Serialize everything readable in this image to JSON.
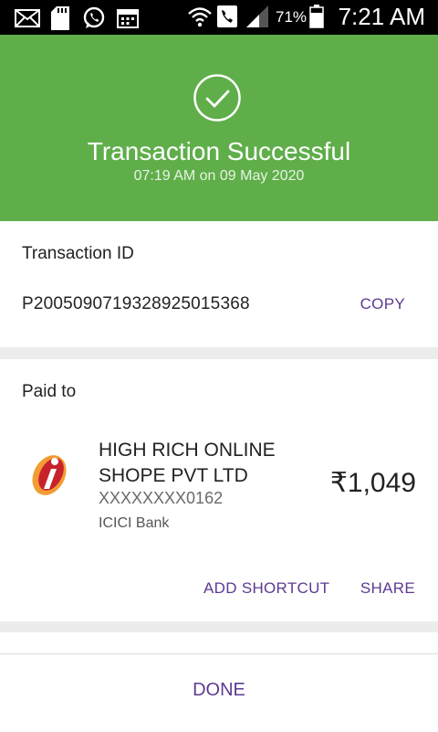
{
  "status_bar": {
    "battery_percent": "71%",
    "time": "7:21 AM"
  },
  "header": {
    "title": "Transaction Successful",
    "timestamp": "07:19 AM on 09 May 2020",
    "accent_color": "#5fae4a"
  },
  "transaction": {
    "id_label": "Transaction ID",
    "id_value": "P2005090719328925015368",
    "copy_label": "COPY"
  },
  "paid_to": {
    "label": "Paid to",
    "merchant_name": "HIGH RICH ONLINE SHOPE PVT LTD",
    "account": "XXXXXXXX0162",
    "bank": "ICICI Bank",
    "amount": "₹1,049",
    "add_shortcut_label": "ADD SHORTCUT",
    "share_label": "SHARE"
  },
  "footer": {
    "done_label": "DONE"
  },
  "icons": [
    "mail-icon",
    "sd-card-icon",
    "whatsapp-icon",
    "calendar-icon",
    "wifi-icon",
    "phone-icon",
    "signal-icon",
    "battery-icon",
    "check-circle-icon",
    "icici-logo-icon"
  ]
}
